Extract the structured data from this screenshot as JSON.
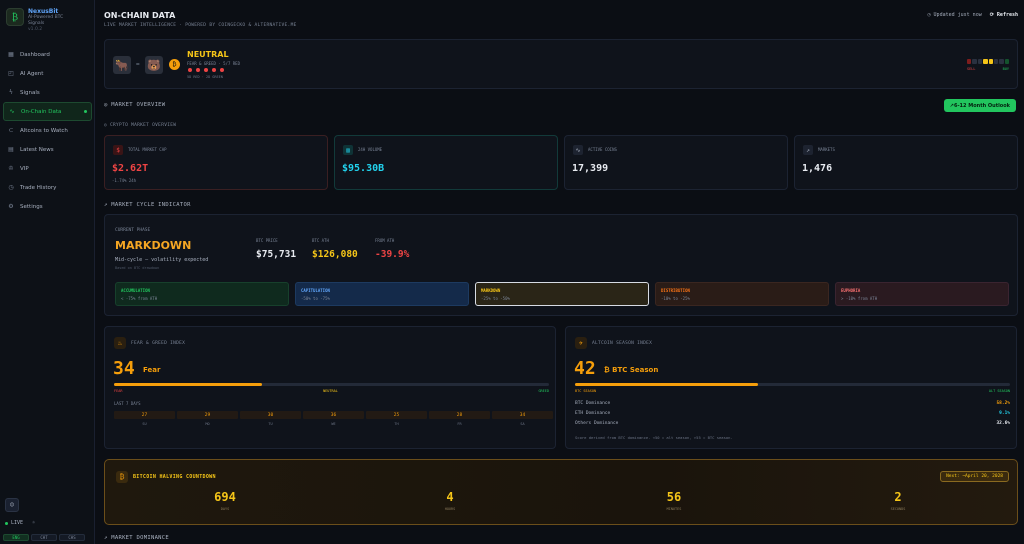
{
  "brand": {
    "name": "NexusBit",
    "tagline1": "AI-Powered BTC",
    "tagline2": "Signals",
    "version": "v1.0.2"
  },
  "sidebar": {
    "items": [
      {
        "label": "Dashboard",
        "icon": "grid-icon"
      },
      {
        "label": "AI Agent",
        "icon": "bot-icon"
      },
      {
        "label": "Signals",
        "icon": "bolt-icon"
      },
      {
        "label": "On-Chain Data",
        "icon": "pulse-icon",
        "active": true
      },
      {
        "label": "Altcoins to Watch",
        "icon": "link-icon"
      },
      {
        "label": "Latest News",
        "icon": "news-icon"
      },
      {
        "label": "VIP",
        "icon": "crown-icon"
      },
      {
        "label": "Trade History",
        "icon": "clock-icon"
      },
      {
        "label": "Settings",
        "icon": "gear-icon"
      }
    ],
    "live": "LIVE",
    "lang": [
      "ENG",
      "CHT",
      "CHS"
    ]
  },
  "header": {
    "title": "ON-CHAIN DATA",
    "subtitle": "LIVE MARKET INTELLIGENCE · POWERED BY COINGECKO & ALTERNATIVE.ME",
    "updated": "Updated just now",
    "refresh": "Refresh"
  },
  "sentiment": {
    "label": "NEUTRAL",
    "sub": "FEAR & GREED · 5/7 RED",
    "note": "5D RED · 2D GREEN",
    "meter_left": "SELL",
    "meter_right": "BUY"
  },
  "overview": {
    "title": "MARKET OVERVIEW",
    "outlook_btn": "6-12 Month Outlook",
    "crypto_title": "CRYPTO MARKET OVERVIEW",
    "stats": [
      {
        "label": "TOTAL MARKET CAP",
        "value": "$2.62T",
        "change": "-1.74% 24h",
        "color": "#ef4444",
        "icon": "dollar-icon"
      },
      {
        "label": "24H VOLUME",
        "value": "$95.30B",
        "change": "",
        "color": "#22d3ee",
        "icon": "bars-icon"
      },
      {
        "label": "ACTIVE COINS",
        "value": "17,399",
        "change": "",
        "color": "#e8ebf1",
        "icon": "pulse-icon"
      },
      {
        "label": "MARKETS",
        "value": "1,476",
        "change": "",
        "color": "#e8ebf1",
        "icon": "trend-icon"
      }
    ]
  },
  "cycle": {
    "title": "MARKET CYCLE INDICATOR",
    "phase_label": "CURRENT PHASE",
    "phase": "MARKDOWN",
    "desc": "Mid-cycle — volatility expected",
    "note": "Based on BTC drawdown",
    "btc_price_label": "BTC PRICE",
    "btc_price": "$75,731",
    "ath_label": "BTC ATH",
    "ath": "$126,080",
    "from_ath_label": "FROM ATH",
    "from_ath": "-39.9%",
    "phases": [
      {
        "name": "ACCUMULATION",
        "range": "< -75% from ATH"
      },
      {
        "name": "CAPITULATION",
        "range": "-50% to -75%"
      },
      {
        "name": "MARKDOWN",
        "range": "-25% to -50%"
      },
      {
        "name": "DISTRIBUTION",
        "range": "-10% to -25%"
      },
      {
        "name": "EUPHORIA",
        "range": "> -10% from ATH"
      }
    ]
  },
  "fear_greed": {
    "title": "FEAR & GREED INDEX",
    "value": "34",
    "label": "Fear",
    "fill": 0.34,
    "ticks": [
      "FEAR",
      "NEUTRAL",
      "GREED"
    ],
    "last7_label": "LAST 7 DAYS",
    "days": [
      {
        "v": "27",
        "d": "SU"
      },
      {
        "v": "29",
        "d": "MO"
      },
      {
        "v": "30",
        "d": "TU"
      },
      {
        "v": "36",
        "d": "WE"
      },
      {
        "v": "25",
        "d": "TH"
      },
      {
        "v": "28",
        "d": "FR"
      },
      {
        "v": "34",
        "d": "SA"
      }
    ]
  },
  "altseason": {
    "title": "ALTCOIN SEASON INDEX",
    "value": "42",
    "label": "₿ BTC Season",
    "fill": 0.42,
    "ticks": [
      "BTC SEASON",
      "ALT SEASON"
    ],
    "rows": [
      {
        "label": "BTC Dominance",
        "value": "58.2%",
        "color": "#f59e0b"
      },
      {
        "label": "ETH Dominance",
        "value": "9.1%",
        "color": "#22d3ee"
      },
      {
        "label": "Others Dominance",
        "value": "32.6%",
        "color": "#e8ebf1"
      }
    ],
    "note": "Score derived from BTC dominance. <50 = alt season, >55 = BTC season."
  },
  "halving": {
    "title": "BITCOIN HALVING COUNTDOWN",
    "next": "Next: ~April 20, 2028",
    "counts": [
      {
        "v": "694",
        "l": "DAYS"
      },
      {
        "v": "4",
        "l": "HOURS"
      },
      {
        "v": "56",
        "l": "MINUTES"
      },
      {
        "v": "2",
        "l": "SECONDS"
      }
    ]
  },
  "dominance_title": "MARKET DOMINANCE",
  "colors": {
    "accent": "#22c55e",
    "warn": "#f59e0b",
    "danger": "#ef4444",
    "cyan": "#22d3ee",
    "gold": "#f5c518"
  }
}
